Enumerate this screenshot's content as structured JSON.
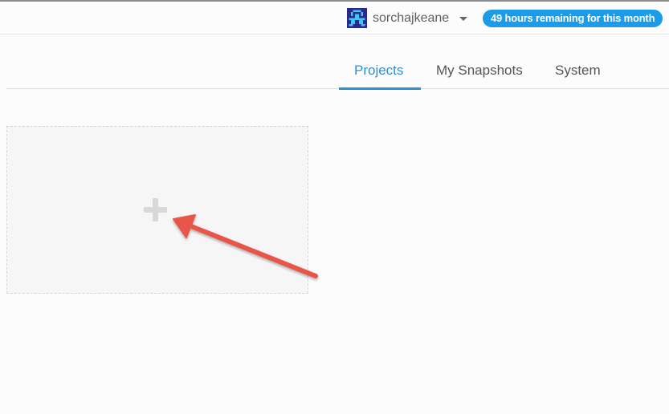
{
  "header": {
    "username": "sorchajkeane",
    "hours_badge": "49 hours remaining for this month",
    "avatar_icon": "pixel-avatar-icon",
    "caret_icon": "caret-down-icon"
  },
  "tabs": [
    {
      "label": "Projects",
      "active": true
    },
    {
      "label": "My Snapshots",
      "active": false
    },
    {
      "label": "System",
      "active": false
    }
  ],
  "new_project_card": {
    "icon": "plus-icon"
  },
  "annotation": {
    "icon": "arrow-icon",
    "color": "#e8574a"
  },
  "colors": {
    "accent": "#2a90d4",
    "badge": "#1a9ce8",
    "avatar_dark": "#2b2a8c",
    "avatar_light": "#3fc6f0"
  }
}
